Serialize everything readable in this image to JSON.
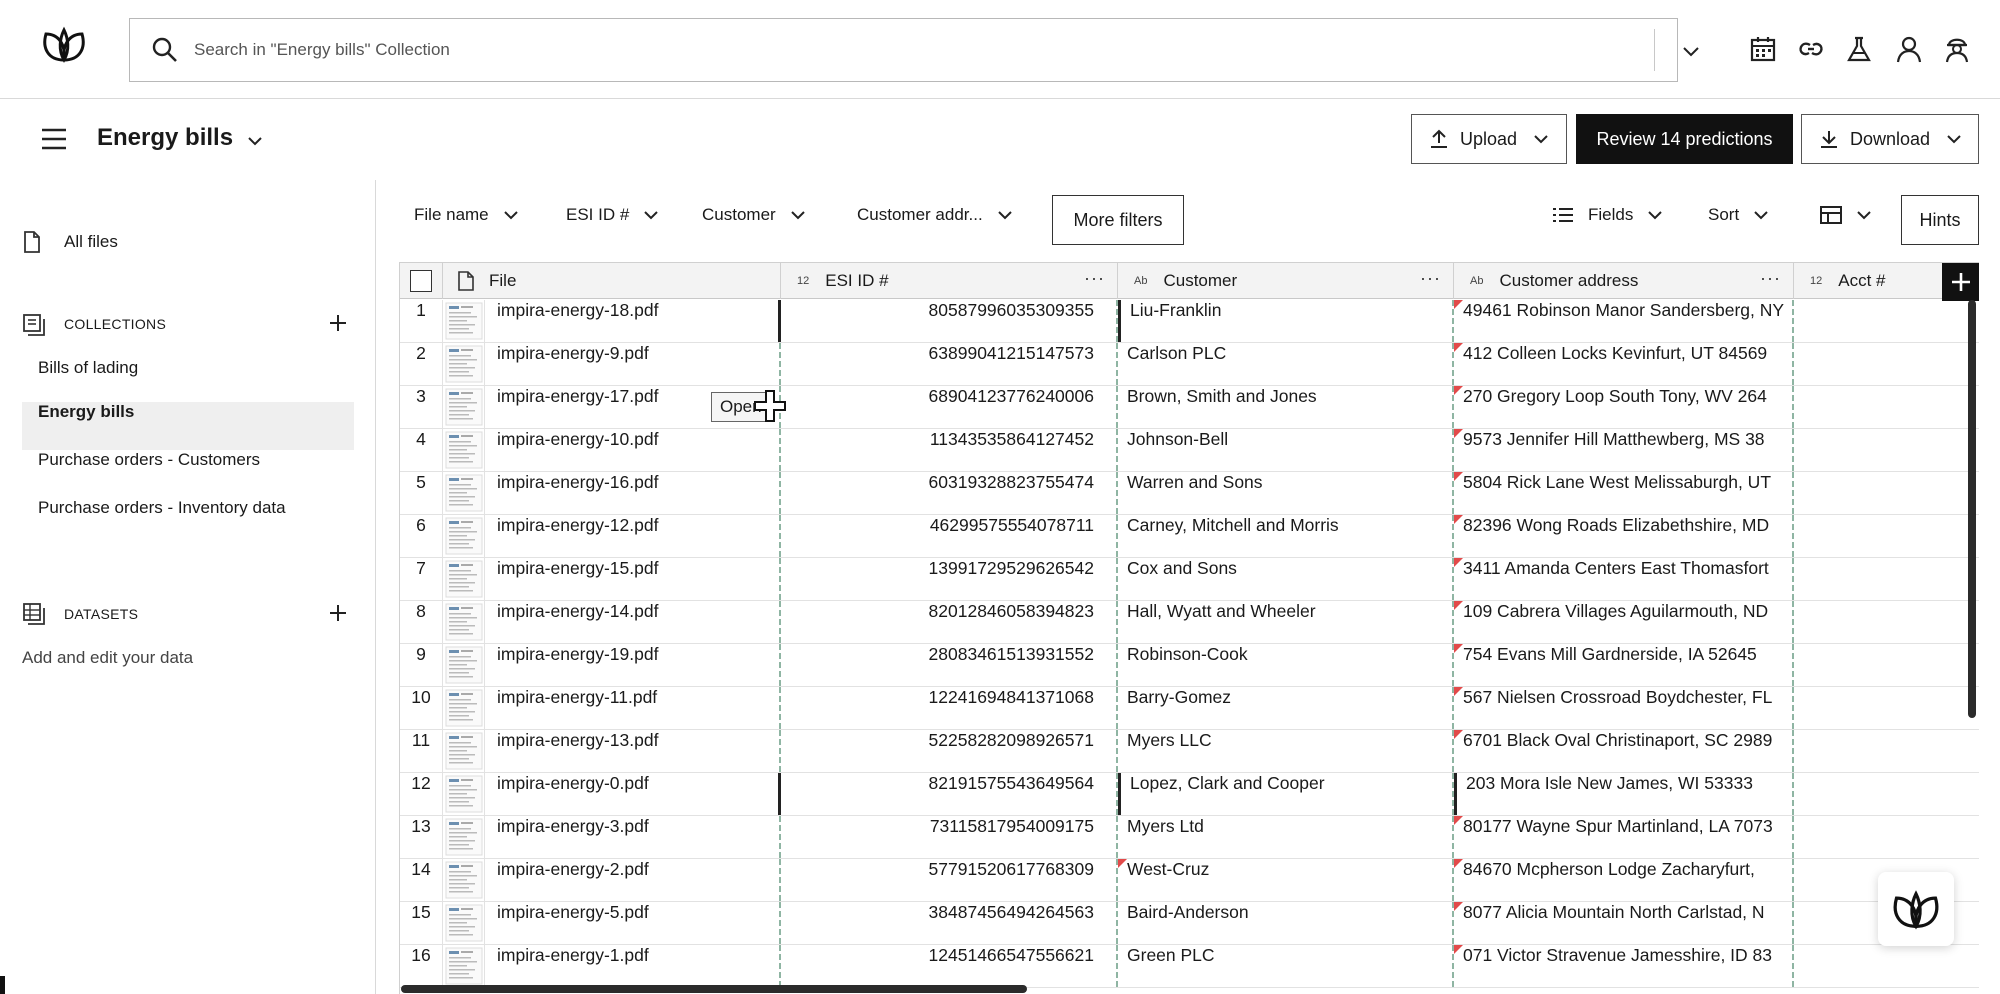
{
  "search": {
    "placeholder": "Search in \"Energy bills\" Collection"
  },
  "top_icons": [
    "calendar-icon",
    "link-icon",
    "flask-icon",
    "user-icon",
    "bot-icon"
  ],
  "header": {
    "collection_title": "Energy bills",
    "upload_label": "Upload",
    "review_label": "Review 14 predictions",
    "download_label": "Download"
  },
  "sidebar": {
    "all_files": "All files",
    "collections_heading": "COLLECTIONS",
    "collections": [
      {
        "label": "Bills of lading",
        "active": false
      },
      {
        "label": "Energy bills",
        "active": true
      },
      {
        "label": "Purchase orders - Customers",
        "active": false
      },
      {
        "label": "Purchase orders - Inventory data",
        "active": false
      }
    ],
    "datasets_heading": "DATASETS",
    "datasets_hint": "Add and edit your data"
  },
  "filters": {
    "file_name": "File name",
    "esi_id": "ESI ID #",
    "customer": "Customer",
    "customer_address": "Customer addr...",
    "more_filters": "More filters",
    "fields": "Fields",
    "sort": "Sort",
    "hints": "Hints"
  },
  "grid": {
    "columns": [
      {
        "type": "",
        "label": "File"
      },
      {
        "type": "12",
        "label": "ESI ID #"
      },
      {
        "type": "Ab",
        "label": "Customer"
      },
      {
        "type": "Ab",
        "label": "Customer address"
      },
      {
        "type": "12",
        "label": "Acct #"
      }
    ],
    "tooltip": "Open",
    "rows": [
      {
        "n": "1",
        "file": "impira-energy-18.pdf",
        "esi": "80587996035309355",
        "customer": "Liu-Franklin",
        "address": "49461 Robinson Manor Sandersberg, NY",
        "acct": ""
      },
      {
        "n": "2",
        "file": "impira-energy-9.pdf",
        "esi": "63899041215147573",
        "customer": "Carlson PLC",
        "address": "412 Colleen Locks Kevinfurt, UT 84569",
        "acct": ""
      },
      {
        "n": "3",
        "file": "impira-energy-17.pdf",
        "esi": "68904123776240006",
        "customer": "Brown, Smith and Jones",
        "address": "270 Gregory Loop South Tony, WV 264",
        "acct": ""
      },
      {
        "n": "4",
        "file": "impira-energy-10.pdf",
        "esi": "11343535864127452",
        "customer": "Johnson-Bell",
        "address": "9573 Jennifer Hill Matthewberg, MS 38",
        "acct": ""
      },
      {
        "n": "5",
        "file": "impira-energy-16.pdf",
        "esi": "60319328823755474",
        "customer": "Warren and Sons",
        "address": "5804 Rick Lane West Melissaburgh, UT",
        "acct": ""
      },
      {
        "n": "6",
        "file": "impira-energy-12.pdf",
        "esi": "46299575554078711",
        "customer": "Carney, Mitchell and Morris",
        "address": "82396 Wong Roads Elizabethshire, MD",
        "acct": ""
      },
      {
        "n": "7",
        "file": "impira-energy-15.pdf",
        "esi": "13991729529626542",
        "customer": "Cox and Sons",
        "address": "3411 Amanda Centers East Thomasfort",
        "acct": ""
      },
      {
        "n": "8",
        "file": "impira-energy-14.pdf",
        "esi": "82012846058394823",
        "customer": "Hall, Wyatt and Wheeler",
        "address": "109 Cabrera Villages Aguilarmouth, ND",
        "acct": ""
      },
      {
        "n": "9",
        "file": "impira-energy-19.pdf",
        "esi": "28083461513931552",
        "customer": "Robinson-Cook",
        "address": "754 Evans Mill Gardnerside, IA 52645",
        "acct": ""
      },
      {
        "n": "10",
        "file": "impira-energy-11.pdf",
        "esi": "12241694841371068",
        "customer": "Barry-Gomez",
        "address": "567 Nielsen Crossroad Boydchester, FL",
        "acct": ""
      },
      {
        "n": "11",
        "file": "impira-energy-13.pdf",
        "esi": "52258282098926571",
        "customer": "Myers LLC",
        "address": "6701 Black Oval Christinaport, SC 2989",
        "acct": ""
      },
      {
        "n": "12",
        "file": "impira-energy-0.pdf",
        "esi": "82191575543649564",
        "customer": "Lopez, Clark and Cooper",
        "address": "203 Mora Isle New James, WI 53333",
        "acct": ""
      },
      {
        "n": "13",
        "file": "impira-energy-3.pdf",
        "esi": "73115817954009175",
        "customer": "Myers Ltd",
        "address": "80177 Wayne Spur Martinland, LA 7073",
        "acct": ""
      },
      {
        "n": "14",
        "file": "impira-energy-2.pdf",
        "esi": "57791520617768309",
        "customer": "West-Cruz",
        "address": "84670 Mcpherson Lodge Zacharyfurt,",
        "acct": ""
      },
      {
        "n": "15",
        "file": "impira-energy-5.pdf",
        "esi": "38487456494264563",
        "customer": "Baird-Anderson",
        "address": "8077 Alicia Mountain North Carlstad, N",
        "acct": ""
      },
      {
        "n": "16",
        "file": "impira-energy-1.pdf",
        "esi": "12451466547556621",
        "customer": "Green PLC",
        "address": "071 Victor Stravenue Jamesshire, ID 83",
        "acct": ""
      }
    ]
  }
}
